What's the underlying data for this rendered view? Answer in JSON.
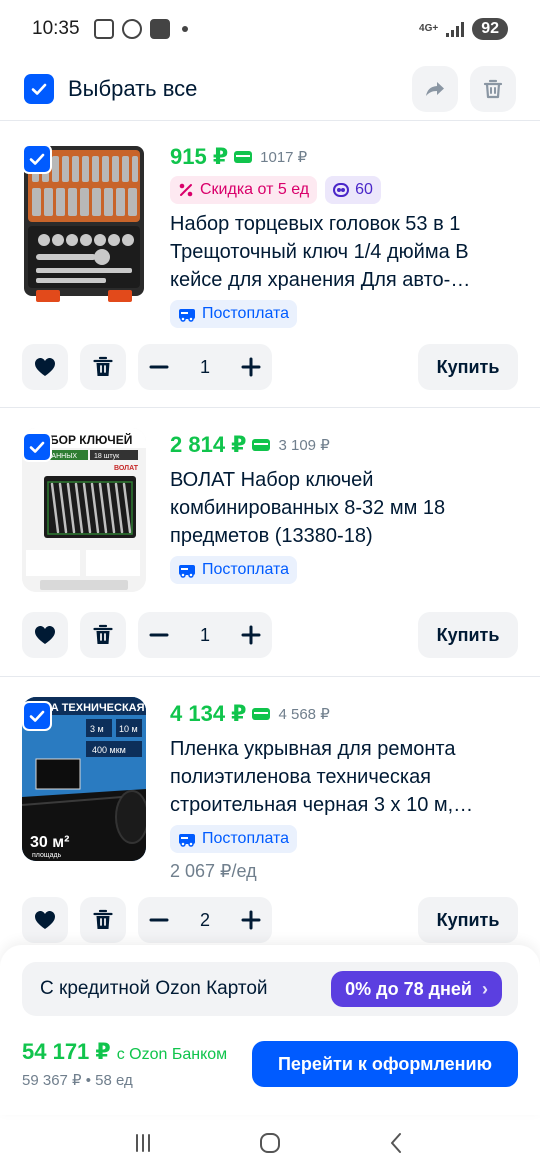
{
  "status_bar": {
    "time": "10:35",
    "network": "4G+",
    "battery": "92"
  },
  "header": {
    "select_all_label": "Выбрать все",
    "share_icon": "share-icon",
    "delete_icon": "trash-icon"
  },
  "products": [
    {
      "price": "915 ₽",
      "old_price": "1017 ₽",
      "discount_badge": "Скидка от 5 ед",
      "points_badge": "60",
      "title": "Набор торцевых головок 53 в 1 Трещоточный ключ 1/4 дюйма В кейсе для хранения Для авто-…",
      "payment_badge": "Постоплата",
      "quantity": "1",
      "buy_label": "Купить"
    },
    {
      "price": "2 814 ₽",
      "old_price": "3 109 ₽",
      "title": "ВОЛАТ Набор ключей комбинированных 8-32 мм 18 предметов (13380-18)",
      "payment_badge": "Постоплата",
      "quantity": "1",
      "buy_label": "Купить",
      "image_text_top": "БОР КЛЮЧЕЙ",
      "image_text_sub": "ИРОВАННЫХ",
      "image_text_count": "18 штук",
      "image_brand": "ВОЛАТ"
    },
    {
      "price": "4 134 ₽",
      "old_price": "4 568 ₽",
      "title": "Пленка укрывная для ремонта полиэтиленова техническая строительная черная 3 х 10 м,…",
      "payment_badge": "Постоплата",
      "unit_price": "2 067 ₽/ед",
      "quantity": "2",
      "buy_label": "Купить",
      "image_text_top": "КА ТЕХНИЧЕСКАЯ",
      "image_text_area": "30 м²",
      "image_text_area_sub": "площадь",
      "image_text_thickness": "400 мкм",
      "image_text_dims_1": "3 м",
      "image_text_dims_2": "10 м"
    }
  ],
  "bottom": {
    "credit_text": "С кредитной Ozon Картой",
    "credit_badge": "0% до 78 дней",
    "total_price": "54 171 ₽",
    "total_with": "с Ozon Банком",
    "total_sub": "59 367 ₽ • 58 ед",
    "checkout_label": "Перейти к оформлению"
  },
  "colors": {
    "accent": "#005bff",
    "price_green": "#10c44c",
    "credit_purple": "#5b3fe0"
  }
}
